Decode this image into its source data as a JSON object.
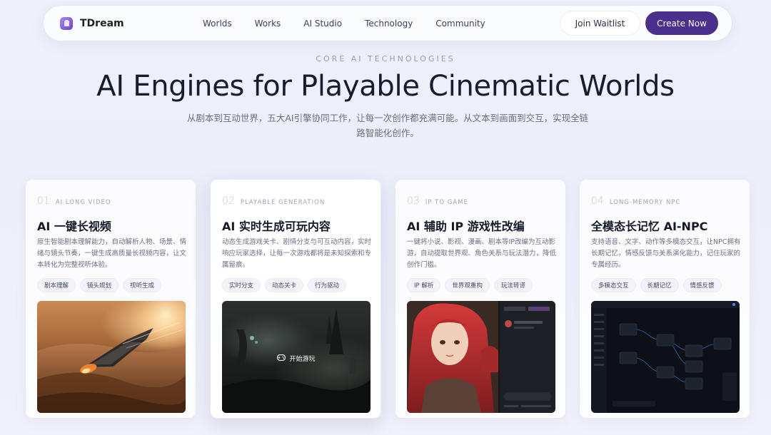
{
  "nav": {
    "brand": "TDream",
    "items": [
      "Worlds",
      "Works",
      "AI Studio",
      "Technology",
      "Community"
    ],
    "join_label": "Join Waitlist",
    "create_label": "Create Now"
  },
  "hero": {
    "eyebrow": "CORE AI TECHNOLOGIES",
    "title": "AI Engines for Playable Cinematic Worlds",
    "subtitle": "从剧本到互动世界，五大AI引擎协同工作，让每一次创作都充满可能。从文本到画面到交互，实现全链路智能化创作。"
  },
  "cards": [
    {
      "num": "01",
      "eng": "AI LONG VIDEO",
      "title": "AI 一键长视频",
      "desc": "原生智能剧本理解能力，自动解析人物、场景、情绪与镜头节奏，一键生成高质量长视频内容，让文本转化为完整视听体验。",
      "chips": [
        "剧本理解",
        "镜头规划",
        "视听生成"
      ]
    },
    {
      "num": "02",
      "eng": "PLAYABLE GENERATION",
      "title": "AI 实时生成可玩内容",
      "desc": "动态生成游戏关卡、剧情分支与可互动内容，实时响应玩家选择，让每一次游戏都将是未知探索和专属留痕。",
      "chips": [
        "实时分支",
        "动态关卡",
        "行为驱动"
      ],
      "play_label": "开始游玩"
    },
    {
      "num": "03",
      "eng": "IP TO GAME",
      "title": "AI 辅助 IP 游戏性改编",
      "desc": "一键将小说、影视、漫画、剧本等IP改编为互动影游，自动提取世界观、角色关系与玩法潜力，降低创作门槛。",
      "chips": [
        "IP 解析",
        "世界观重构",
        "玩法转译"
      ]
    },
    {
      "num": "04",
      "eng": "LONG-MEMORY NPC",
      "title": "全模态长记忆 AI-NPC",
      "desc": "支持语音、文字、动作等多模态交互，让NPC拥有长期记忆，情感反馈与关系演化能力，记住玩家的专属经历。",
      "chips": [
        "多模态交互",
        "长期记忆",
        "情感反馈"
      ]
    }
  ]
}
